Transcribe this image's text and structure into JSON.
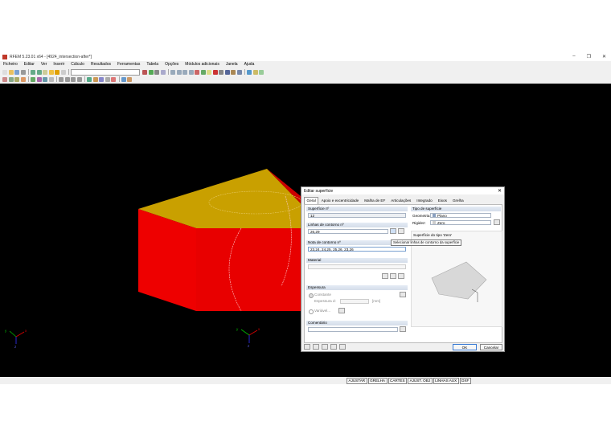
{
  "app": {
    "title": "RFEM 5.23.01 x64 - [4924_intersection-after*]",
    "menu": [
      "Ficheiro",
      "Editar",
      "Ver",
      "Inserir",
      "Cálculo",
      "Resultados",
      "Ferramentas",
      "Tabela",
      "Opções",
      "Módulos adicionais",
      "Janela",
      "Ajuda"
    ],
    "window_buttons": {
      "minimize": "–",
      "restore": "❐",
      "close": "✕"
    }
  },
  "statusbar": [
    "AJUSTAR",
    "GRELHA",
    "CARTES",
    "AJUST. OBJ",
    "LINHAS AUX",
    "DXF"
  ],
  "axes": {
    "x": "x",
    "y": "y",
    "z": "z"
  },
  "dialog": {
    "title": "Editar superfície",
    "close": "✕",
    "tabs": [
      "Geral",
      "Apoio e excentricidade",
      "Malha de EF",
      "Articulações",
      "Integrado",
      "Eixos",
      "Grelha"
    ],
    "active_tab": "Geral",
    "surface_no_label": "Superfície nº",
    "surface_no": "12",
    "boundary_lines_label": "Linhas de contorno nº",
    "boundary_lines": "26,29",
    "boundary_notes_label": "Nota de contorno nº",
    "boundary_notes": "23,24, 24,25, 25,26, 23,26",
    "material_label": "Material",
    "thickness_label": "Espessura",
    "thickness_constant": "Constante",
    "thickness_d_label": "Espessura d:",
    "thickness_unit": "[mm]",
    "thickness_variable": "Variável...",
    "comment_label": "Comentário",
    "surface_type_label": "Tipo de superfície",
    "geometry_label": "Geometria:",
    "geometry_value": "Plano",
    "stiffness_label": "Rigidez:",
    "stiffness_value": "Zero",
    "preview_caption": "Superfície do tipo 'Zero'",
    "tooltip": "Selecionar linhas de contorno da superfície",
    "ok": "OK",
    "cancel": "Cancelar"
  },
  "colors": {
    "box_front": "#ee0000",
    "box_top": "#c9a000",
    "viewport": "#000000"
  }
}
